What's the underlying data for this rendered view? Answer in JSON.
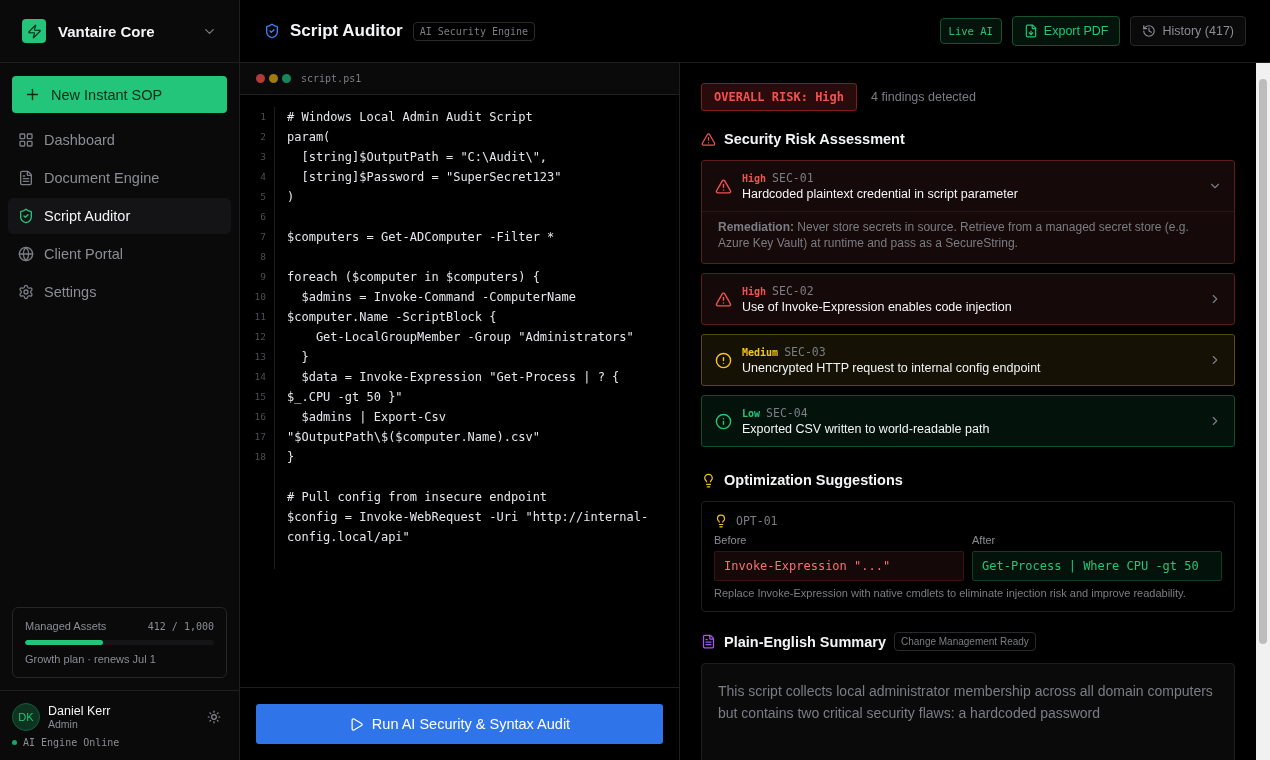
{
  "workspace": {
    "name": "Vantaire Core"
  },
  "new_button": {
    "label": "New Instant SOP"
  },
  "nav": [
    {
      "kind": "dashboard",
      "label": "Dashboard",
      "selected": false
    },
    {
      "kind": "document",
      "label": "Document Engine",
      "selected": false
    },
    {
      "kind": "shield",
      "label": "Script Auditor",
      "selected": true
    },
    {
      "kind": "globe",
      "label": "Client Portal",
      "selected": false
    },
    {
      "kind": "settings",
      "label": "Settings",
      "selected": false
    }
  ],
  "usage": {
    "label": "Managed Assets",
    "count": "412 / 1,000",
    "level": 0.412,
    "plan": "Growth plan · renews Jul 1"
  },
  "user": {
    "initials": "DK",
    "name": "Daniel Kerr",
    "role": "Admin",
    "status": "AI Engine Online"
  },
  "header": {
    "title": "Script Auditor",
    "badge": "AI Security Engine",
    "live": "Live AI",
    "export": "Export PDF",
    "history": "History (417)"
  },
  "editor": {
    "filename": "script.ps1",
    "line_numbers": [
      "1",
      "2",
      "3",
      "4",
      "5",
      "6",
      "7",
      "8",
      "9",
      "10",
      "11",
      "12",
      "13",
      "14",
      "15",
      "16",
      "17",
      "18"
    ],
    "lines": [
      {
        "kind": "code",
        "text": "# Windows Local Admin Audit Script"
      },
      {
        "kind": "code",
        "text": "param("
      },
      {
        "kind": "code",
        "text": "  [string]$OutputPath = \"C:\\Audit\\\","
      },
      {
        "kind": "code",
        "text": "  [string]$Password = \"SuperSecret123\""
      },
      {
        "kind": "code",
        "text": ")"
      },
      {
        "kind": "blank"
      },
      {
        "kind": "code",
        "text": "$computers = Get-ADComputer -Filter *"
      },
      {
        "kind": "blank"
      },
      {
        "kind": "code",
        "text": "foreach ($computer in $computers) {"
      },
      {
        "kind": "code",
        "text": "  $admins = Invoke-Command -ComputerName"
      },
      {
        "kind": "code",
        "text": "$computer.Name -ScriptBlock {"
      },
      {
        "kind": "code",
        "text": "    Get-LocalGroupMember -Group \"Administrators\""
      },
      {
        "kind": "code",
        "text": "  }"
      },
      {
        "kind": "code",
        "text": "  $data = Invoke-Expression \"Get-Process | ? {"
      },
      {
        "kind": "code",
        "text": "$_.CPU -gt 50 }\""
      },
      {
        "kind": "code",
        "text": "  $admins | Export-Csv"
      },
      {
        "kind": "code",
        "text": "\"$OutputPath\\$($computer.Name).csv\""
      },
      {
        "kind": "code",
        "text": "}"
      },
      {
        "kind": "blank"
      },
      {
        "kind": "code",
        "text": "# Pull config from insecure endpoint"
      },
      {
        "kind": "code",
        "text": "$config = Invoke-WebRequest -Uri \"http://internal-"
      },
      {
        "kind": "code",
        "text": "config.local/api\""
      }
    ],
    "run_button": "Run AI Security & Syntax Audit"
  },
  "report": {
    "overall": "OVERALL RISK: High",
    "findings_count": "4 findings detected",
    "risk_title": "Security Risk Assessment",
    "findings": [
      {
        "kind": "high",
        "level_label": "High",
        "id": "SEC-01",
        "title": "Hardcoded plaintext credential in script parameter",
        "expanded": true,
        "remediation": "**Remediation:** Never store secrets in source. Retrieve from a managed secret store (e.g. Azure Key Vault) at runtime and pass as a SecureString."
      },
      {
        "kind": "high",
        "level_label": "High",
        "id": "SEC-02",
        "title": "Use of Invoke-Expression enables code injection",
        "expanded": false
      },
      {
        "kind": "medium",
        "level_label": "Medium",
        "id": "SEC-03",
        "title": "Unencrypted HTTP request to internal config endpoint",
        "expanded": false
      },
      {
        "kind": "low",
        "level_label": "Low",
        "id": "SEC-04",
        "title": "Exported CSV written to world-readable path",
        "expanded": false
      }
    ],
    "opt_title": "Optimization Suggestions",
    "optimization": {
      "id": "OPT-01",
      "before_label": "Before",
      "before": "Invoke-Expression \"...\"",
      "after_label": "After",
      "after": "Get-Process | Where CPU -gt 50",
      "note": "Replace Invoke-Expression with native cmdlets to eliminate injection risk and improve readability."
    },
    "summary_title": "Plain-English Summary",
    "summary_badge": "Change Management Ready",
    "summary": "This script collects local administrator membership across all domain computers but contains two critical security flaws: a hardcoded password"
  }
}
